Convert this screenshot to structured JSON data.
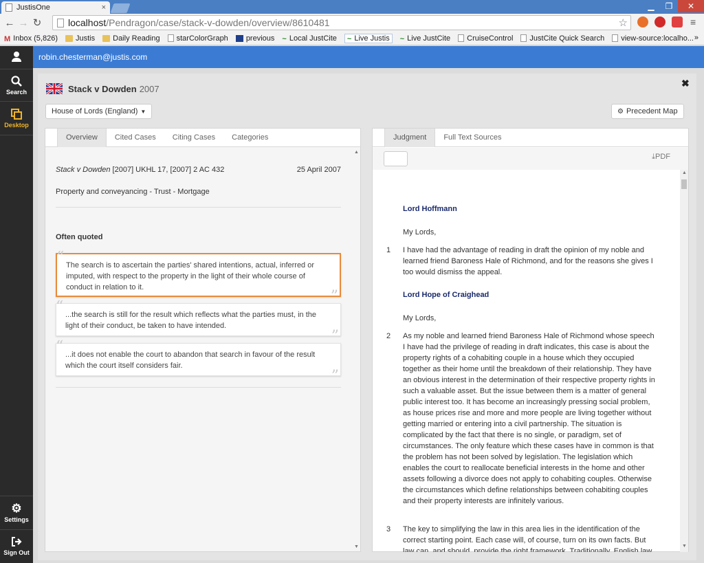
{
  "browser": {
    "tab_title": "JustisOne",
    "tab_close": "×",
    "url_host": "localhost",
    "url_path": "/Pendragon/case/stack-v-dowden/overview/8610481",
    "bookmarks": [
      {
        "label": "Inbox (5,826)",
        "icon": "gmail-icon"
      },
      {
        "label": "Justis",
        "icon": "folder-icon"
      },
      {
        "label": "Daily Reading",
        "icon": "folder-icon"
      },
      {
        "label": "starColorGraph",
        "icon": "page-icon"
      },
      {
        "label": "previous",
        "icon": "sv-icon"
      },
      {
        "label": "Local JustCite",
        "icon": "wave-icon"
      },
      {
        "label": "Live Justis",
        "icon": "wave-icon"
      },
      {
        "label": "Live JustCite",
        "icon": "wave-icon"
      },
      {
        "label": "CruiseControl",
        "icon": "page-icon"
      },
      {
        "label": "JustCite Quick Search",
        "icon": "page-icon"
      },
      {
        "label": "view-source:localho...",
        "icon": "page-icon"
      }
    ],
    "more": "»"
  },
  "sidebar": {
    "search": "Search",
    "desktop": "Desktop",
    "settings": "Settings",
    "signout": "Sign Out"
  },
  "user": {
    "email": "robin.chesterman@justis.com"
  },
  "case": {
    "name": "Stack v Dowden",
    "year": "2007",
    "court": "House of Lords (England)",
    "map_button": "Precedent Map",
    "citation_name": "Stack v Dowden",
    "citation_refs": " [2007] UKHL 17, [2007] 2 AC 432",
    "date": "25 April 2007",
    "subject": "Property and conveyancing - Trust - Mortgage"
  },
  "left_tabs": [
    "Overview",
    "Cited Cases",
    "Citing Cases",
    "Categories"
  ],
  "often_quoted": {
    "heading": "Often quoted",
    "quotes": [
      "The search is to ascertain the parties' shared intentions, actual, inferred or imputed, with respect to the property in the light of their whole course of conduct in relation to it.",
      "...the search is still for the result which reflects what the parties must, in the light of their conduct, be taken to have intended.",
      "...it does not enable the court to abandon that search in favour of the result which the court itself considers fair."
    ]
  },
  "right_tabs": [
    "Judgment",
    "Full Text Sources"
  ],
  "pdf_label": "PDF",
  "judgment": {
    "judge1": "Lord Hoffmann",
    "salutation1": "My Lords,",
    "p1_num": "1",
    "p1": "I have had the advantage of reading in draft the opinion of my noble and learned friend Baroness Hale of Richmond, and for the reasons she gives I too would dismiss the appeal.",
    "judge2": "Lord Hope of Craighead",
    "salutation2": "My Lords,",
    "p2_num": "2",
    "p2": "As my noble and learned friend Baroness Hale of Richmond whose speech I have had the privilege of reading in draft indicates, this case is about the property rights of a cohabiting couple in a house which they occupied together as their home until the breakdown of their relationship. They have an obvious interest in the determination of their respective property rights in such a valuable asset. But the issue between them is a matter of general public interest too. It has become an increasingly pressing social problem, as house prices rise and more and more people are living together without getting married or entering into a civil partnership. The situation is complicated by the fact that there is no single, or paradigm, set of circumstances. The only feature which these cases have in common is that the problem has not been solved by legislation. The legislation which enables the court to reallocate beneficial interests in the home and other assets following a divorce does not apply to cohabiting couples. Otherwise the circumstances which define relationships between cohabiting couples and their property interests are infinitely various.",
    "p3_num": "3",
    "p3": "The key to simplifying the law in this area lies in the identification of the correct starting point. Each case will, of course, turn on its own facts. But law can, and should, provide the right framework. Traditionally, English law"
  }
}
